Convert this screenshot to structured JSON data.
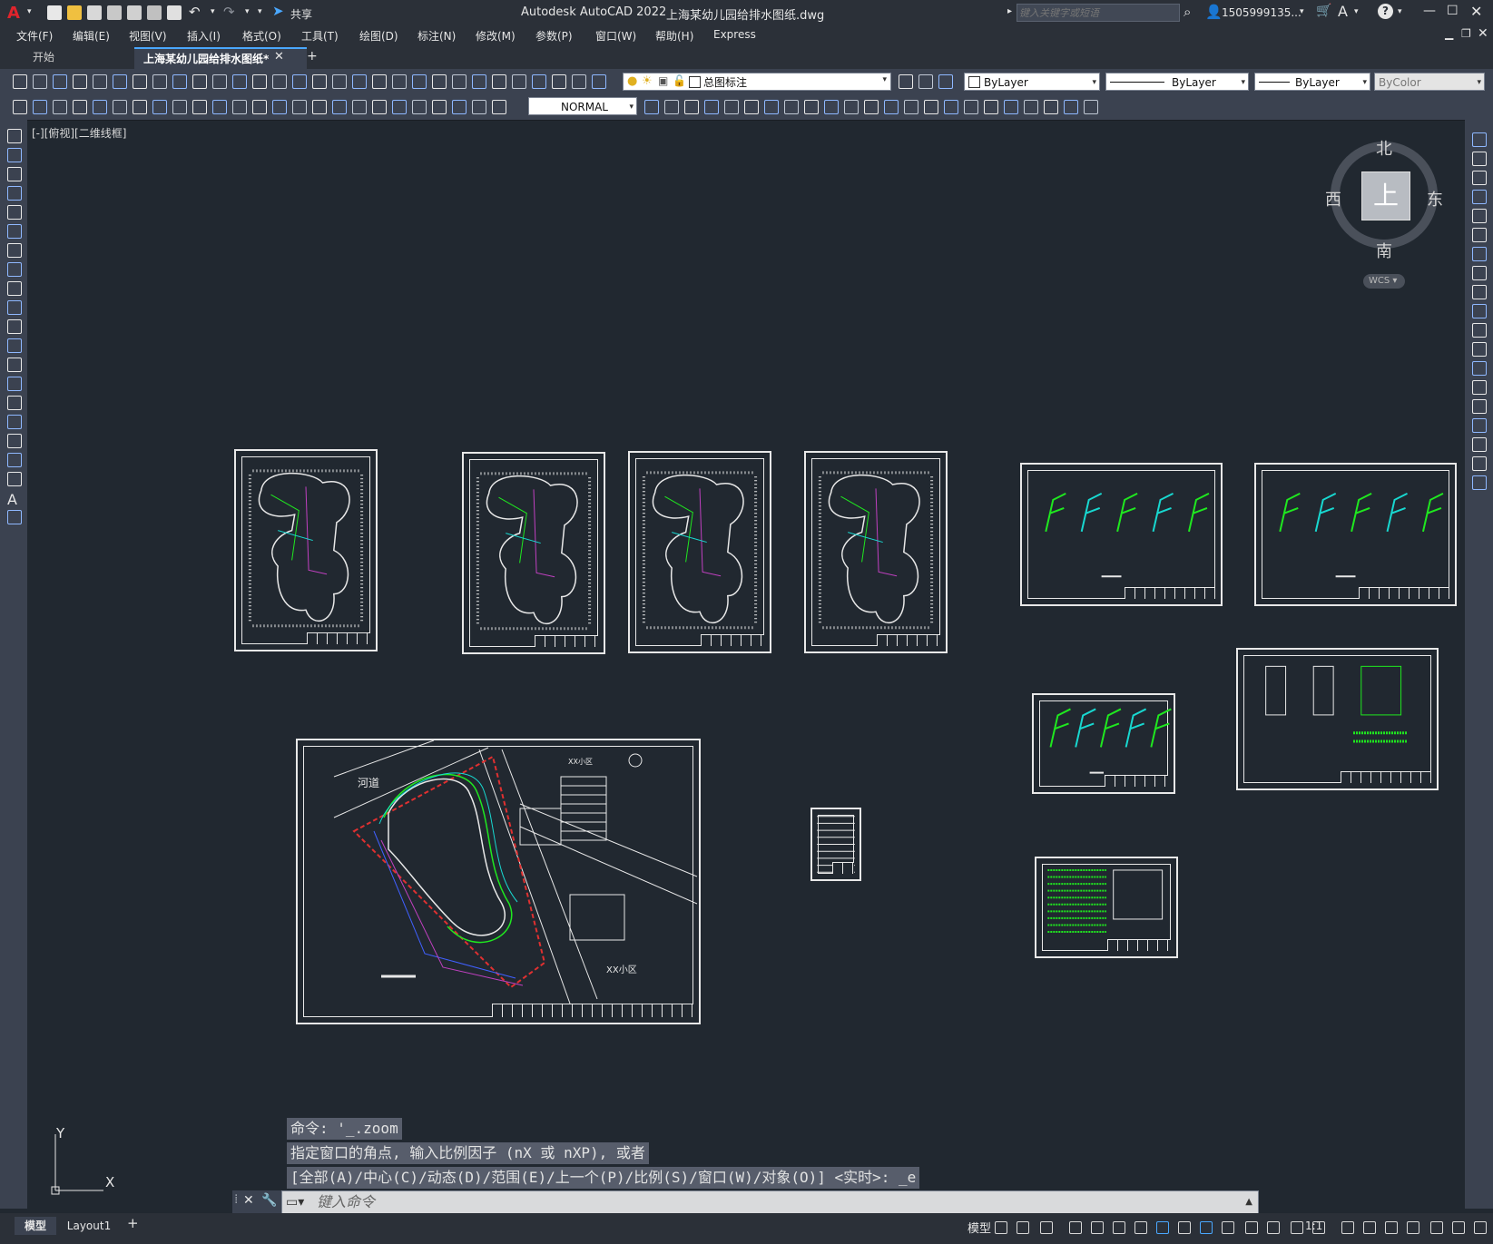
{
  "titlebar": {
    "share": "共享",
    "app_title": "Autodesk AutoCAD 2022",
    "file_title": "上海某幼儿园给排水图纸.dwg",
    "search_placeholder": "键入关键字或短语",
    "user": "1505999135...",
    "help": "?"
  },
  "menu": [
    "文件(F)",
    "编辑(E)",
    "视图(V)",
    "插入(I)",
    "格式(O)",
    "工具(T)",
    "绘图(D)",
    "标注(N)",
    "修改(M)",
    "参数(P)",
    "窗口(W)",
    "帮助(H)",
    "Express"
  ],
  "tabs": {
    "start": "开始",
    "drawing": "上海某幼儿园给排水图纸*",
    "add": "+"
  },
  "toolbar": {
    "layer": "总图标注",
    "color": "ByLayer",
    "linetype": "ByLayer",
    "lineweight": "ByLayer",
    "plotstyle": "ByColor",
    "textstyle": "NORMAL"
  },
  "viewport_label": "[-][俯视][二维线框]",
  "viewcube": {
    "north": "北",
    "south": "南",
    "east": "东",
    "west": "西",
    "top": "上",
    "wcs": "WCS"
  },
  "drawing_labels": {
    "river": "河道",
    "community1": "XX小区",
    "community2": "XX小区"
  },
  "ucs": {
    "x": "X",
    "y": "Y"
  },
  "command_history": [
    "命令: '_.zoom",
    "指定窗口的角点, 输入比例因子 (nX 或 nXP), 或者",
    "[全部(A)/中心(C)/动态(D)/范围(E)/上一个(P)/比例(S)/窗口(W)/对象(O)] <实时>: _e"
  ],
  "command_placeholder": "键入命令",
  "status": {
    "model_tab": "模型",
    "layout_tab": "Layout1",
    "add": "+",
    "model": "模型",
    "scale": "1:1"
  },
  "colors": {
    "accent_green": "#1fe81f",
    "accent_cyan": "#18d8d0",
    "magenta": "#c040c0",
    "bg": "#212830"
  }
}
